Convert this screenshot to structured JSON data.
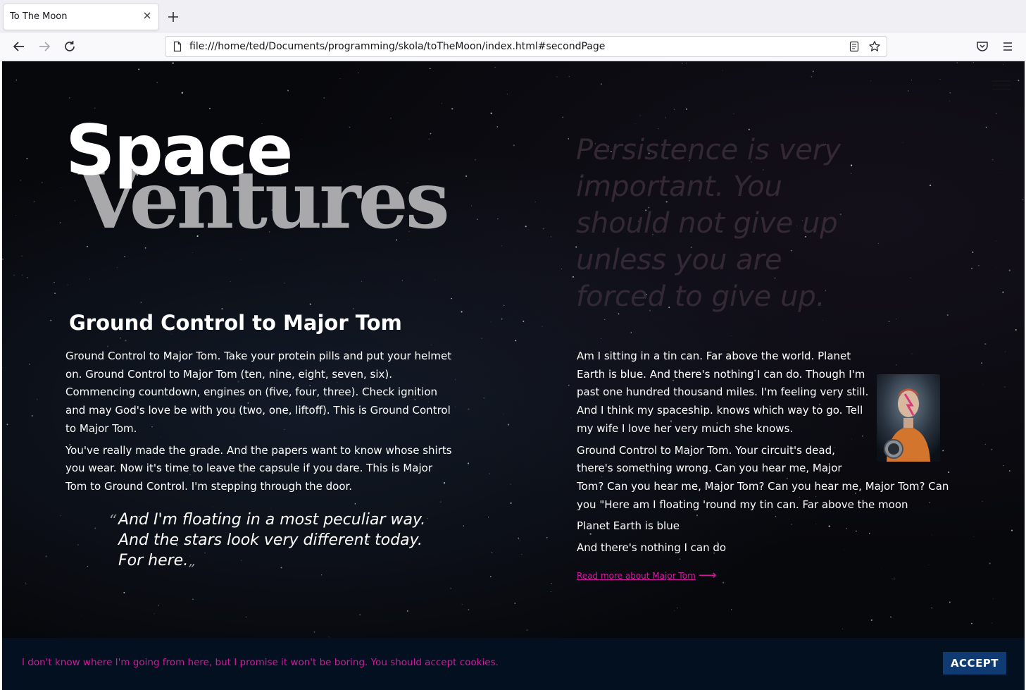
{
  "browser": {
    "tab_title": "To The Moon",
    "url": "file:///home/ted/Documents/programming/skola/toTheMoon/index.html#secondPage"
  },
  "hero": {
    "word_top": "Space",
    "word_bottom": "Ventures"
  },
  "persistence_quote": "Persistence is very important. You should not give up unless you are forced to give up.",
  "section": {
    "heading": "Ground Control to Major Tom",
    "left_paragraphs": [
      "Ground Control to Major Tom. Take your protein pills and put your helmet on. Ground Control to Major Tom (ten, nine, eight, seven, six). Commencing countdown, engines on (five, four, three). Check ignition and may God's love be with you (two, one, liftoff). This is Ground Control to Major Tom.",
      "You've really made the grade. And the papers want to know whose shirts you wear. Now it's time to leave the capsule if you dare. This is Major Tom to Ground Control. I'm stepping through the door."
    ],
    "quote_lines": [
      "And I'm floating in a most peculiar way.",
      "And the stars look very different today.",
      "For here."
    ],
    "quote_open_mark": "“",
    "quote_close_mark": "„",
    "right_paragraphs": [
      "Am I sitting in a tin can. Far above the world. Planet Earth is blue. And there's nothing I can do. Though I'm past one hundred thousand miles. I'm feeling very still. And I think my spaceship. knows which way to go. Tell my wife I love her very much she knows.",
      "Ground Control to Major Tom. Your circuit's dead, there's something wrong. Can you hear me, Major Tom? Can you hear me, Major Tom? Can you hear me, Major Tom? Can you \"Here am I floating 'round my tin can. Far above the moon",
      "Planet Earth is blue",
      "And there's nothing I can do"
    ],
    "read_more": "Read more about Major Tom",
    "read_more_arrow": "⟶"
  },
  "cookie": {
    "text": "I don't know where I'm going from here, but I promise it won't be boring. You should accept cookies.",
    "accept_label": "ACCEPT"
  },
  "colors": {
    "accent_pink": "#d21aa0",
    "cookie_bg": "#03101f",
    "accept_bg": "#103b72",
    "ventures_gray": "#a9a9ab"
  }
}
